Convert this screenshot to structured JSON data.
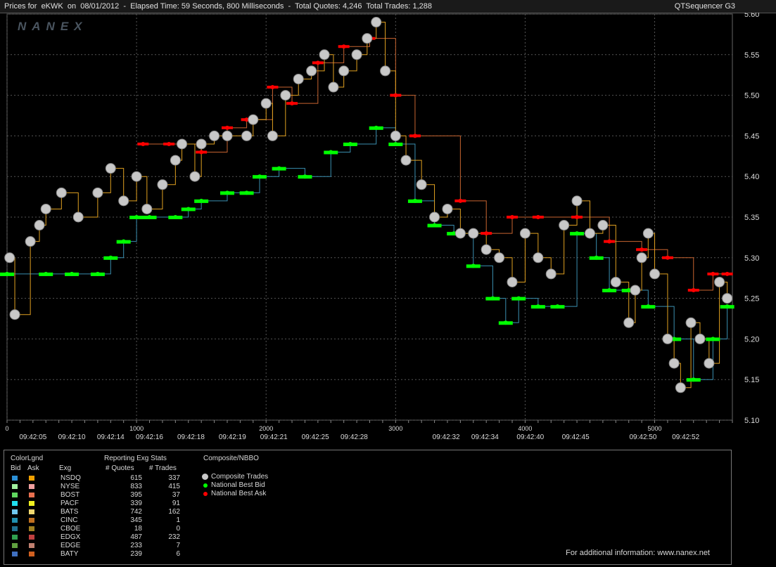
{
  "header": {
    "title": "Prices for  eKWK  on  08/01/2012  -  Elapsed Time: 59 Seconds, 800 Milliseconds  -  Total Quotes: 4,246  Total Trades: 1,288",
    "app": "QTSequencer G3",
    "watermark": "NANEX"
  },
  "chart_data": {
    "type": "scatter",
    "y_axis": {
      "min": 5.1,
      "max": 5.6,
      "ticks": [
        "5.10",
        "5.15",
        "5.20",
        "5.25",
        "5.30",
        "5.35",
        "5.40",
        "5.45",
        "5.50",
        "5.55",
        "5.60"
      ],
      "position": "right"
    },
    "x_axis_seq": {
      "min": 0,
      "max": 5600,
      "ticks": [
        0,
        1000,
        2000,
        3000,
        4000,
        5000
      ]
    },
    "time_labels": [
      {
        "seq": 200,
        "t": "09:42:05"
      },
      {
        "seq": 500,
        "t": "09:42:10"
      },
      {
        "seq": 800,
        "t": "09:42:14"
      },
      {
        "seq": 1100,
        "t": "09:42:16"
      },
      {
        "seq": 1420,
        "t": "09:42:18"
      },
      {
        "seq": 1740,
        "t": "09:42:19"
      },
      {
        "seq": 2060,
        "t": "09:42:21"
      },
      {
        "seq": 2380,
        "t": "09:42:25"
      },
      {
        "seq": 2680,
        "t": "09:42:28"
      },
      {
        "seq": 3390,
        "t": "09:42:32"
      },
      {
        "seq": 3690,
        "t": "09:42:34"
      },
      {
        "seq": 4040,
        "t": "09:42:40"
      },
      {
        "seq": 4390,
        "t": "09:42:45"
      },
      {
        "seq": 4910,
        "t": "09:42:50"
      },
      {
        "seq": 5240,
        "t": "09:42:52"
      }
    ],
    "grid": true,
    "series": [
      {
        "name": "Composite Trades",
        "color": "#c8c8c8",
        "points": [
          [
            20,
            5.3
          ],
          [
            60,
            5.23
          ],
          [
            180,
            5.32
          ],
          [
            250,
            5.34
          ],
          [
            300,
            5.36
          ],
          [
            420,
            5.38
          ],
          [
            550,
            5.35
          ],
          [
            700,
            5.38
          ],
          [
            800,
            5.41
          ],
          [
            900,
            5.37
          ],
          [
            1000,
            5.4
          ],
          [
            1080,
            5.36
          ],
          [
            1200,
            5.39
          ],
          [
            1300,
            5.42
          ],
          [
            1350,
            5.44
          ],
          [
            1450,
            5.4
          ],
          [
            1500,
            5.44
          ],
          [
            1600,
            5.45
          ],
          [
            1700,
            5.45
          ],
          [
            1850,
            5.45
          ],
          [
            1900,
            5.47
          ],
          [
            2000,
            5.49
          ],
          [
            2050,
            5.45
          ],
          [
            2150,
            5.5
          ],
          [
            2250,
            5.52
          ],
          [
            2350,
            5.53
          ],
          [
            2450,
            5.55
          ],
          [
            2520,
            5.51
          ],
          [
            2600,
            5.53
          ],
          [
            2700,
            5.55
          ],
          [
            2780,
            5.57
          ],
          [
            2850,
            5.59
          ],
          [
            2920,
            5.53
          ],
          [
            3000,
            5.45
          ],
          [
            3080,
            5.42
          ],
          [
            3200,
            5.39
          ],
          [
            3300,
            5.35
          ],
          [
            3400,
            5.36
          ],
          [
            3500,
            5.33
          ],
          [
            3600,
            5.33
          ],
          [
            3700,
            5.31
          ],
          [
            3800,
            5.3
          ],
          [
            3900,
            5.27
          ],
          [
            4000,
            5.33
          ],
          [
            4100,
            5.3
          ],
          [
            4200,
            5.28
          ],
          [
            4300,
            5.34
          ],
          [
            4400,
            5.37
          ],
          [
            4500,
            5.33
          ],
          [
            4600,
            5.34
          ],
          [
            4700,
            5.27
          ],
          [
            4800,
            5.22
          ],
          [
            4850,
            5.26
          ],
          [
            4900,
            5.3
          ],
          [
            4950,
            5.33
          ],
          [
            5000,
            5.28
          ],
          [
            5100,
            5.2
          ],
          [
            5150,
            5.17
          ],
          [
            5200,
            5.14
          ],
          [
            5280,
            5.22
          ],
          [
            5350,
            5.2
          ],
          [
            5420,
            5.17
          ],
          [
            5500,
            5.27
          ],
          [
            5560,
            5.25
          ]
        ]
      },
      {
        "name": "National Best Bid",
        "color": "#00ff00",
        "points": [
          [
            0,
            5.28
          ],
          [
            300,
            5.28
          ],
          [
            500,
            5.28
          ],
          [
            700,
            5.28
          ],
          [
            800,
            5.3
          ],
          [
            900,
            5.32
          ],
          [
            1000,
            5.35
          ],
          [
            1100,
            5.35
          ],
          [
            1300,
            5.35
          ],
          [
            1400,
            5.36
          ],
          [
            1500,
            5.37
          ],
          [
            1700,
            5.38
          ],
          [
            1850,
            5.38
          ],
          [
            1950,
            5.4
          ],
          [
            2100,
            5.41
          ],
          [
            2300,
            5.4
          ],
          [
            2500,
            5.43
          ],
          [
            2650,
            5.44
          ],
          [
            2850,
            5.46
          ],
          [
            3000,
            5.44
          ],
          [
            3150,
            5.37
          ],
          [
            3300,
            5.34
          ],
          [
            3450,
            5.33
          ],
          [
            3600,
            5.29
          ],
          [
            3750,
            5.25
          ],
          [
            3850,
            5.22
          ],
          [
            3950,
            5.25
          ],
          [
            4100,
            5.24
          ],
          [
            4250,
            5.24
          ],
          [
            4400,
            5.33
          ],
          [
            4550,
            5.3
          ],
          [
            4650,
            5.26
          ],
          [
            4800,
            5.26
          ],
          [
            4950,
            5.24
          ],
          [
            5150,
            5.2
          ],
          [
            5300,
            5.15
          ],
          [
            5450,
            5.2
          ],
          [
            5560,
            5.24
          ]
        ]
      },
      {
        "name": "National Best Ask",
        "color": "#ff0000",
        "points": [
          [
            1050,
            5.44
          ],
          [
            1250,
            5.44
          ],
          [
            1500,
            5.43
          ],
          [
            1700,
            5.46
          ],
          [
            1850,
            5.47
          ],
          [
            2050,
            5.51
          ],
          [
            2200,
            5.49
          ],
          [
            2400,
            5.54
          ],
          [
            2600,
            5.56
          ],
          [
            2800,
            5.57
          ],
          [
            3000,
            5.5
          ],
          [
            3150,
            5.45
          ],
          [
            3500,
            5.37
          ],
          [
            3700,
            5.33
          ],
          [
            3900,
            5.35
          ],
          [
            4100,
            5.35
          ],
          [
            4400,
            5.35
          ],
          [
            4650,
            5.32
          ],
          [
            4900,
            5.31
          ],
          [
            5100,
            5.3
          ],
          [
            5300,
            5.26
          ],
          [
            5450,
            5.28
          ],
          [
            5560,
            5.28
          ]
        ]
      }
    ]
  },
  "legend": {
    "colorlgnd": "ColorLgnd",
    "bid": "Bid",
    "ask": "Ask",
    "exg": "Exg",
    "stats_header": "Reporting Exg Stats",
    "col_quotes": "# Quotes",
    "col_trades": "# Trades",
    "composite_header": "Composite/NBBO",
    "composite_items": [
      {
        "label": "Composite Trades",
        "color": "#c8c8c8"
      },
      {
        "label": "National Best Bid",
        "color": "#00ff00"
      },
      {
        "label": "National Best Ask",
        "color": "#ff0000"
      }
    ],
    "exchanges": [
      {
        "exg": "NSDQ",
        "quotes": "615",
        "trades": "337",
        "bid": "#2b8fd6",
        "ask": "#f0a000"
      },
      {
        "exg": "NYSE",
        "quotes": "833",
        "trades": "415",
        "bid": "#a0f0a0",
        "ask": "#f0a0a0"
      },
      {
        "exg": "BOST",
        "quotes": "395",
        "trades": "37",
        "bid": "#60d860",
        "ask": "#e87050"
      },
      {
        "exg": "PACF",
        "quotes": "339",
        "trades": "91",
        "bid": "#20e0f0",
        "ask": "#f0f020"
      },
      {
        "exg": "BATS",
        "quotes": "742",
        "trades": "162",
        "bid": "#70c8f0",
        "ask": "#f0d870"
      },
      {
        "exg": "CINC",
        "quotes": "345",
        "trades": "1",
        "bid": "#2090b0",
        "ask": "#c07020"
      },
      {
        "exg": "CBOE",
        "quotes": "18",
        "trades": "0",
        "bid": "#207090",
        "ask": "#a08020"
      },
      {
        "exg": "EDGX",
        "quotes": "487",
        "trades": "232",
        "bid": "#30a050",
        "ask": "#c04040"
      },
      {
        "exg": "EDGE",
        "quotes": "233",
        "trades": "7",
        "bid": "#60a040",
        "ask": "#c08070"
      },
      {
        "exg": "BATY",
        "quotes": "239",
        "trades": "6",
        "bid": "#4070c0",
        "ask": "#d06020"
      }
    ]
  },
  "footer": {
    "link": "For additional information: www.nanex.net"
  }
}
